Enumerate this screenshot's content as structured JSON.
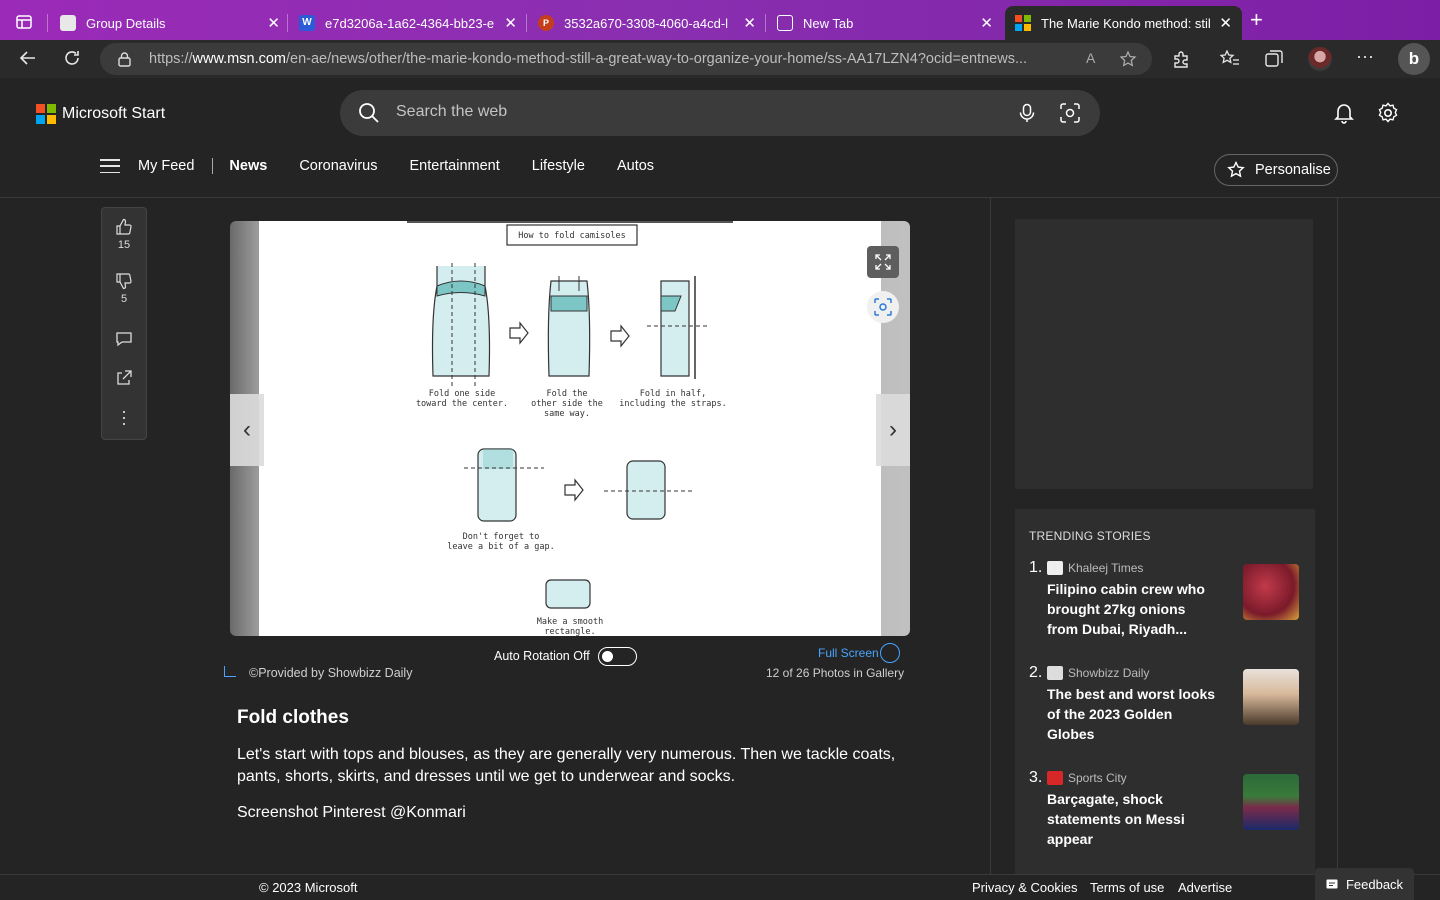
{
  "browser": {
    "tabs": [
      {
        "title": "Group Details"
      },
      {
        "title": "e7d3206a-1a62-4364-bb23-e"
      },
      {
        "title": "3532a670-3308-4060-a4cd-l"
      },
      {
        "title": "New Tab"
      },
      {
        "title": "The Marie Kondo method: still"
      }
    ],
    "url_prefix": "https://",
    "url_domain": "www.msn.com",
    "url_path": "/en-ae/news/other/the-marie-kondo-method-still-a-great-way-to-organize-your-home/ss-AA17LZN4?ocid=entnews..."
  },
  "header": {
    "logo_text": "Microsoft Start",
    "search_placeholder": "Search the web",
    "nav": [
      "My Feed",
      "News",
      "Coronavirus",
      "Entertainment",
      "Lifestyle",
      "Autos"
    ],
    "personalise": "Personalise"
  },
  "reactions": {
    "likes": "15",
    "dislikes": "5"
  },
  "illustration": {
    "title": "How to fold camisoles",
    "step1": [
      "Fold one side",
      "toward the center."
    ],
    "step2": [
      "Fold the",
      "other side the",
      "same way."
    ],
    "step3": [
      "Fold in half,",
      "including the straps."
    ],
    "step4": [
      "Don't forget to",
      "leave a bit of a gap."
    ],
    "step5": [
      "Make a smooth",
      "rectangle."
    ]
  },
  "gallery": {
    "auto_rotation": "Auto Rotation Off",
    "full_screen": "Full Screen",
    "provided_by": "©Provided by Showbizz Daily",
    "count": "12 of 26 Photos in Gallery"
  },
  "article": {
    "title": "Fold clothes",
    "body": "Let's start with tops and blouses, as they are generally very numerous. Then we tackle coats, pants, shorts, skirts, and dresses until we get to underwear and socks.",
    "credit": "Screenshot Pinterest @Konmari"
  },
  "trending": {
    "heading": "TRENDING STORIES",
    "stories": [
      {
        "num": "1.",
        "source": "Khaleej Times",
        "headline": "Filipino cabin crew who brought 27kg onions from Dubai, Riyadh..."
      },
      {
        "num": "2.",
        "source": "Showbizz Daily",
        "headline": "The best and worst looks of the 2023 Golden Globes"
      },
      {
        "num": "3.",
        "source": "Sports City",
        "headline": "Barçagate, shock statements on Messi appear"
      }
    ]
  },
  "footer": {
    "copyright": "© 2023 Microsoft",
    "privacy": "Privacy & Cookies",
    "terms": "Terms of use",
    "advertise": "Advertise",
    "feedback": "Feedback"
  }
}
